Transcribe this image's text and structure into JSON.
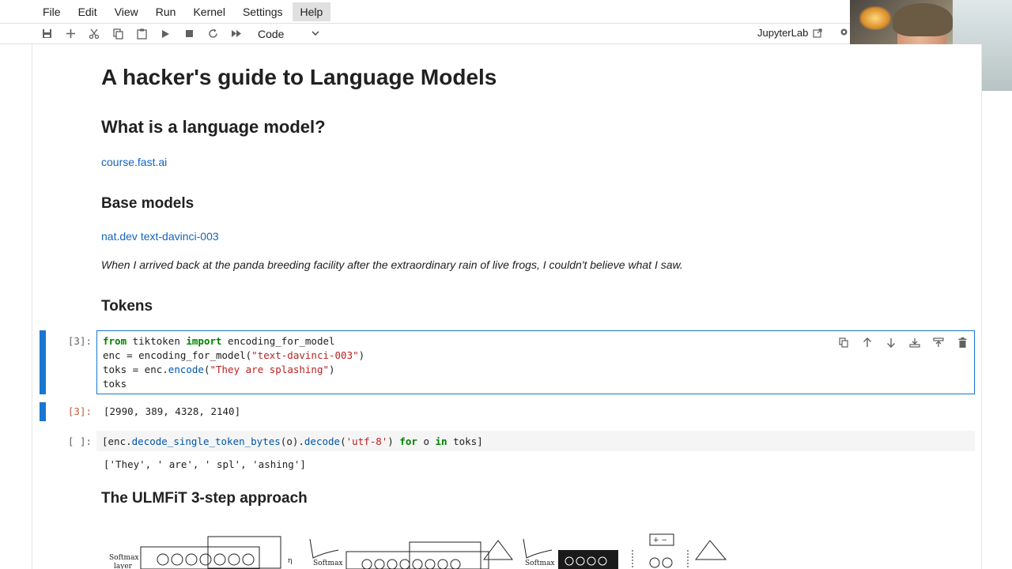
{
  "menu": {
    "items": [
      "File",
      "Edit",
      "View",
      "Run",
      "Kernel",
      "Settings",
      "Help"
    ],
    "active": "Help"
  },
  "toolbar": {
    "cell_type": "Code",
    "jupyterlab_label": "JupyterLab",
    "icons": [
      "save-icon",
      "add-cell-icon",
      "cut-icon",
      "copy-icon",
      "paste-icon",
      "run-icon",
      "stop-icon",
      "restart-icon",
      "fast-forward-icon"
    ]
  },
  "notebook": {
    "title": "A hacker's guide to Language Models",
    "section_what": "What is a language model?",
    "course_link": "course.fast.ai",
    "section_base": "Base models",
    "natdev_link": "nat.dev text-davinci-003",
    "quote": "When I arrived back at the panda breeding facility after the extraordinary rain of live frogs, I couldn't believe what I saw.",
    "section_tokens": "Tokens",
    "cell1": {
      "prompt": "[3]:",
      "line1_kw1": "from",
      "line1_mid": " tiktoken ",
      "line1_kw2": "import",
      "line1_end": " encoding_for_model",
      "line2_a": "enc = encoding_for_model(",
      "line2_str": "\"text-davinci-003\"",
      "line2_b": ")",
      "line3_a": "toks = enc.",
      "line3_fn": "encode",
      "line3_b": "(",
      "line3_str": "\"They are splashing\"",
      "line3_c": ")",
      "line4": "toks",
      "out_prompt": "[3]:",
      "output": "[2990, 389, 4328, 2140]"
    },
    "cell2": {
      "prompt": "[ ]:",
      "code_a": "[enc.",
      "code_fn": "decode_single_token_bytes",
      "code_b": "(o).",
      "code_fn2": "decode",
      "code_c": "(",
      "code_str": "'utf-8'",
      "code_d": ") ",
      "code_kw1": "for",
      "code_e": " o ",
      "code_kw2": "in",
      "code_f": " toks]",
      "output": "['They', ' are', ' spl', 'ashing']"
    },
    "section_ulmfit": "The ULMFiT 3-step approach"
  },
  "diagram": {
    "softmax": "Softmax",
    "layer": "layer",
    "softmax2": "Softmax",
    "softmax3": "Softmax",
    "plusminus": "+ −"
  }
}
